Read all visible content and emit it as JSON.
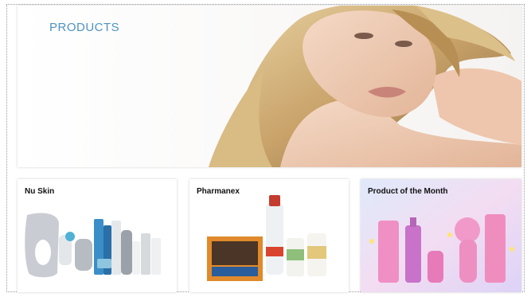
{
  "hero": {
    "title": "PRODUCTS"
  },
  "cards": [
    {
      "title": "Nu Skin"
    },
    {
      "title": "Pharmanex"
    },
    {
      "title": "Product of the Month"
    }
  ]
}
